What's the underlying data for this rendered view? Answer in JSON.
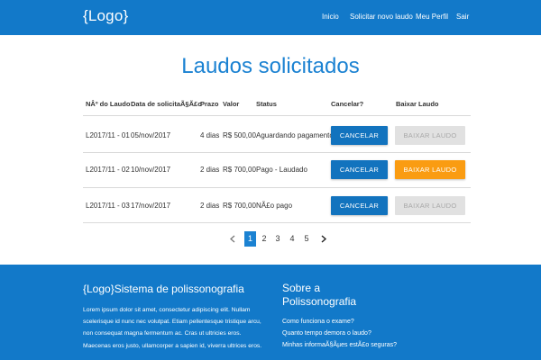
{
  "navbar": {
    "logo": "{Logo}",
    "links": [
      "Inicio",
      "Solicitar novo laudo",
      "Meu Perfil",
      "Sair"
    ]
  },
  "page_title": "Laudos solicitados",
  "table": {
    "headers": [
      "NÂº do Laudo",
      "Data de solicitaÃ§Ã£o",
      "Prazo",
      "Valor",
      "Status",
      "Cancelar?",
      "Baixar Laudo"
    ],
    "rows": [
      {
        "laudo": "L2017/11 - 01",
        "data": "05/nov/2017",
        "prazo": "4 dias",
        "valor": "R$ 500,00",
        "status": "Aguardando pagamento",
        "cancel_label": "CANCELAR",
        "download_label": "BAIXAR LAUDO",
        "download_enabled": false
      },
      {
        "laudo": "L2017/11 - 02",
        "data": "10/nov/2017",
        "prazo": "2 dias",
        "valor": "R$ 700,00",
        "status": "Pago - Laudado",
        "cancel_label": "CANCELAR",
        "download_label": "BAIXAR LAUDO",
        "download_enabled": true
      },
      {
        "laudo": "L2017/11 - 03",
        "data": "17/nov/2017",
        "prazo": "2 dias",
        "valor": "R$ 700,00",
        "status": "NÃ£o pago",
        "cancel_label": "CANCELAR",
        "download_label": "BAIXAR LAUDO",
        "download_enabled": false
      }
    ]
  },
  "pagination": {
    "pages": [
      "1",
      "2",
      "3",
      "4",
      "5"
    ],
    "current": "1",
    "prev_icon": "chevron-left-icon",
    "next_icon": "chevron-right-icon"
  },
  "footer": {
    "title": "{Logo}Sistema de polissonografia",
    "text_lines": [
      "Lorem ipsum dolor sit amet, consectetur adipiscing elit. Nullam",
      "scelerisque id nunc nec volutpat. Etiam pellentesque tristique arcu,",
      "non consequat magna fermentum ac. Cras ut ultricies eros.",
      "Maecenas eros justo, ullamcorper a sapien id, viverra ultrices eros."
    ],
    "about_heading": "Sobre a Polissonografia",
    "about_links": [
      "Como funciona o exame?",
      "Quanto tempo demora o laudo?",
      "Minhas informaÃ§Ãµes estÃ£o seguras?"
    ]
  },
  "colors": {
    "primary": "#1279c9",
    "title": "#1b82d2",
    "cancel_button": "#1273be",
    "download_active": "#fa9c12",
    "download_disabled": "#e1e1e1"
  }
}
